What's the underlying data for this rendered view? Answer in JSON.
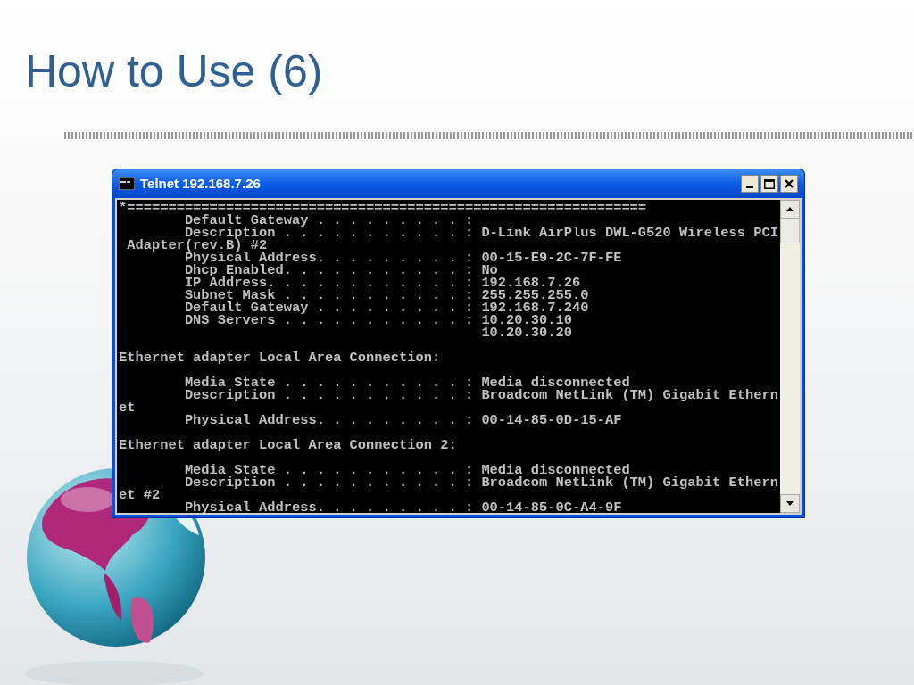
{
  "slide": {
    "title": "How to Use (6)"
  },
  "window": {
    "title": "Telnet 192.168.7.26",
    "buttons": [
      {
        "kind": "minimize"
      },
      {
        "kind": "maximize"
      },
      {
        "kind": "close"
      }
    ]
  },
  "console": {
    "blocks": [
      {
        "lines": [
          "*===============================================================",
          "        Default Gateway . . . . . . . . . :",
          "        Description . . . . . . . . . . . : D-Link AirPlus DWL-G520 Wireless PCI",
          " Adapter(rev.B) #2",
          "        Physical Address. . . . . . . . . : 00-15-E9-2C-7F-FE",
          "        Dhcp Enabled. . . . . . . . . . . : No",
          "        IP Address. . . . . . . . . . . . : 192.168.7.26",
          "        Subnet Mask . . . . . . . . . . . : 255.255.255.0",
          "        Default Gateway . . . . . . . . . : 192.168.7.240",
          "        DNS Servers . . . . . . . . . . . : 10.20.30.10",
          "                                            10.20.30.20"
        ]
      },
      {
        "lines": [
          "Ethernet adapter Local Area Connection:"
        ]
      },
      {
        "lines": [
          "        Media State . . . . . . . . . . . : Media disconnected",
          "        Description . . . . . . . . . . . : Broadcom NetLink (TM) Gigabit Ethern",
          "et",
          "        Physical Address. . . . . . . . . : 00-14-85-0D-15-AF"
        ]
      },
      {
        "lines": [
          "Ethernet adapter Local Area Connection 2:"
        ]
      },
      {
        "lines": [
          "        Media State . . . . . . . . . . . : Media disconnected",
          "        Description . . . . . . . . . . . : Broadcom NetLink (TM) Gigabit Ethern",
          "et #2",
          "        Physical Address. . . . . . . . . : 00-14-85-0C-A4-9F"
        ]
      }
    ]
  }
}
